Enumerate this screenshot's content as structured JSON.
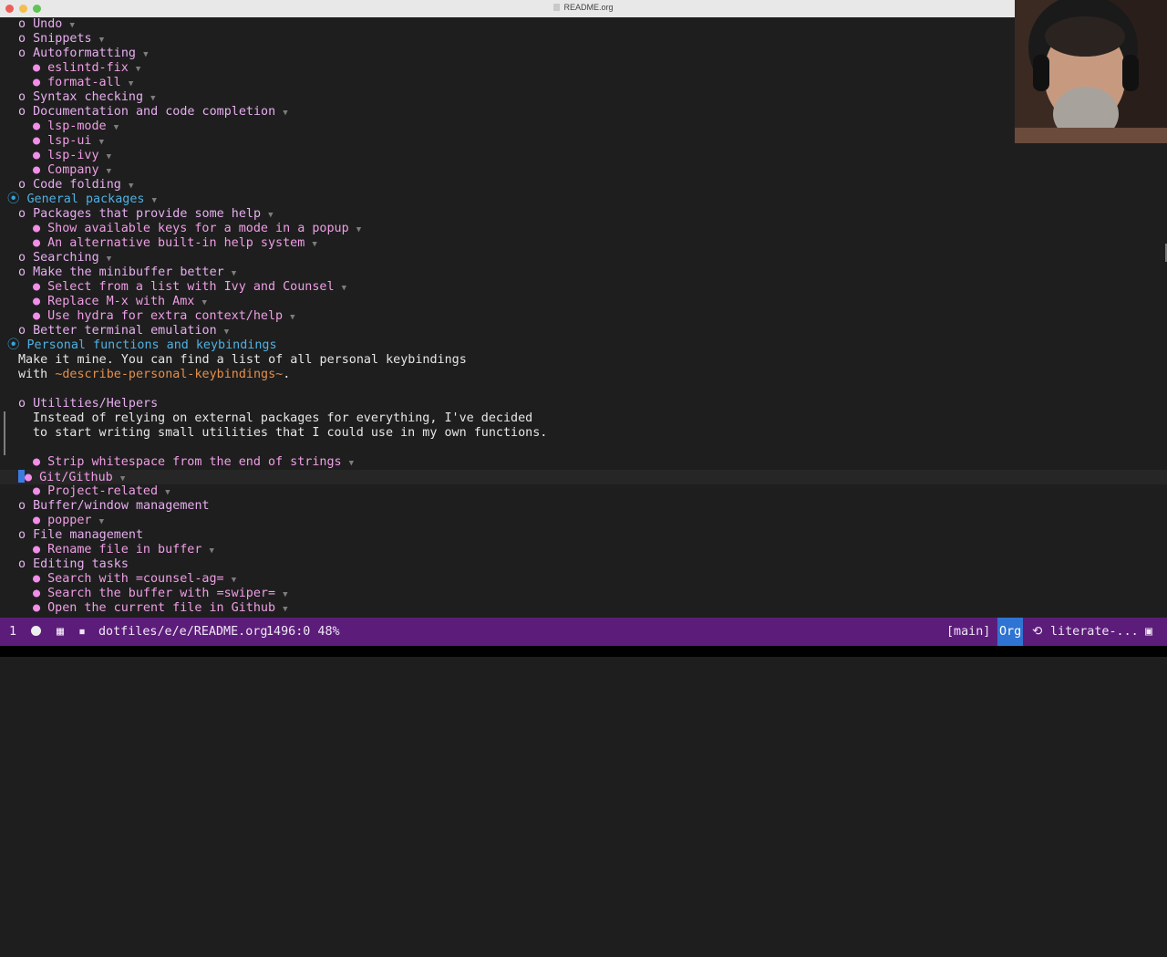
{
  "window": {
    "title": "README.org"
  },
  "outline": [
    {
      "level": 2,
      "text": "Undo",
      "fold": true
    },
    {
      "level": 2,
      "text": "Snippets",
      "fold": true
    },
    {
      "level": 2,
      "text": "Autoformatting",
      "fold": true
    },
    {
      "level": 3,
      "text": "eslintd-fix",
      "fold": true
    },
    {
      "level": 3,
      "text": "format-all",
      "fold": true
    },
    {
      "level": 2,
      "text": "Syntax checking",
      "fold": true
    },
    {
      "level": 2,
      "text": "Documentation and code completion",
      "fold": true
    },
    {
      "level": 3,
      "text": "lsp-mode",
      "fold": true
    },
    {
      "level": 3,
      "text": "lsp-ui",
      "fold": true
    },
    {
      "level": 3,
      "text": "lsp-ivy",
      "fold": true
    },
    {
      "level": 3,
      "text": "Company",
      "fold": true
    },
    {
      "level": 2,
      "text": "Code folding",
      "fold": true
    },
    {
      "level": 1,
      "text": "General packages",
      "fold": true
    },
    {
      "level": 2,
      "text": "Packages that provide some help",
      "fold": true
    },
    {
      "level": 3,
      "text": "Show available keys for a mode in a popup",
      "fold": true
    },
    {
      "level": 3,
      "text": "An alternative built-in help system",
      "fold": true
    },
    {
      "level": 2,
      "text": "Searching",
      "fold": true
    },
    {
      "level": 2,
      "text": "Make the minibuffer better",
      "fold": true
    },
    {
      "level": 3,
      "text": "Select from a list with Ivy and Counsel",
      "fold": true
    },
    {
      "level": 3,
      "text": "Replace M-x with Amx",
      "fold": true
    },
    {
      "level": 3,
      "text": "Use hydra for extra context/help",
      "fold": true
    },
    {
      "level": 2,
      "text": "Better terminal emulation",
      "fold": true
    },
    {
      "level": 1,
      "text": "Personal functions and keybindings",
      "fold": false
    },
    {
      "level": 0,
      "text": "Make it mine. You can find a list of all personal keybindings"
    },
    {
      "level": 0,
      "text": "with ",
      "code": "~describe-personal-keybindings~",
      "after": "."
    },
    {
      "level": -1
    },
    {
      "level": 2,
      "text": "Utilities/Helpers",
      "fold": false
    },
    {
      "level": 0,
      "text": "Instead of relying on external packages for everything, I've decided",
      "body": 2
    },
    {
      "level": 0,
      "text": "to start writing small utilities that I could use in my own functions.",
      "body": 2
    },
    {
      "level": -1
    },
    {
      "level": 3,
      "text": "Strip whitespace from the end of strings",
      "fold": true
    },
    {
      "level": 3,
      "text": "Git/Github",
      "fold": true,
      "current": true
    },
    {
      "level": 3,
      "text": "Project-related",
      "fold": true
    },
    {
      "level": 2,
      "text": "Buffer/window management",
      "fold": false
    },
    {
      "level": 3,
      "text": "popper",
      "fold": true
    },
    {
      "level": 2,
      "text": "File management",
      "fold": false
    },
    {
      "level": 3,
      "text": "Rename file in buffer",
      "fold": true
    },
    {
      "level": 2,
      "text": "Editing tasks",
      "fold": false
    },
    {
      "level": 3,
      "text": "Search with ",
      "code": "=counsel-ag=",
      "fold": true
    },
    {
      "level": 3,
      "text": "Search the buffer with ",
      "code": "=swiper=",
      "fold": true
    },
    {
      "level": 3,
      "text": "Open the current file in Github",
      "fold": true
    }
  ],
  "symbols": {
    "level1": "⦿",
    "level2": "o",
    "level3": "●",
    "fold": "▼"
  },
  "modeline": {
    "window_number": "1",
    "buffer_name": "dotfiles/e/e/README.org",
    "position": "1496:0 48%",
    "branch": "[main]",
    "mode": "Org",
    "vcs_label": "literate-..."
  },
  "colors": {
    "background": "#1e1e1e",
    "heading1": "#4fb1e3",
    "heading2": "#e7aef0",
    "heading3": "#f09ee6",
    "code": "#e58f4b",
    "modeline": "#5c1d7a",
    "mode_highlight": "#2f73d3"
  }
}
